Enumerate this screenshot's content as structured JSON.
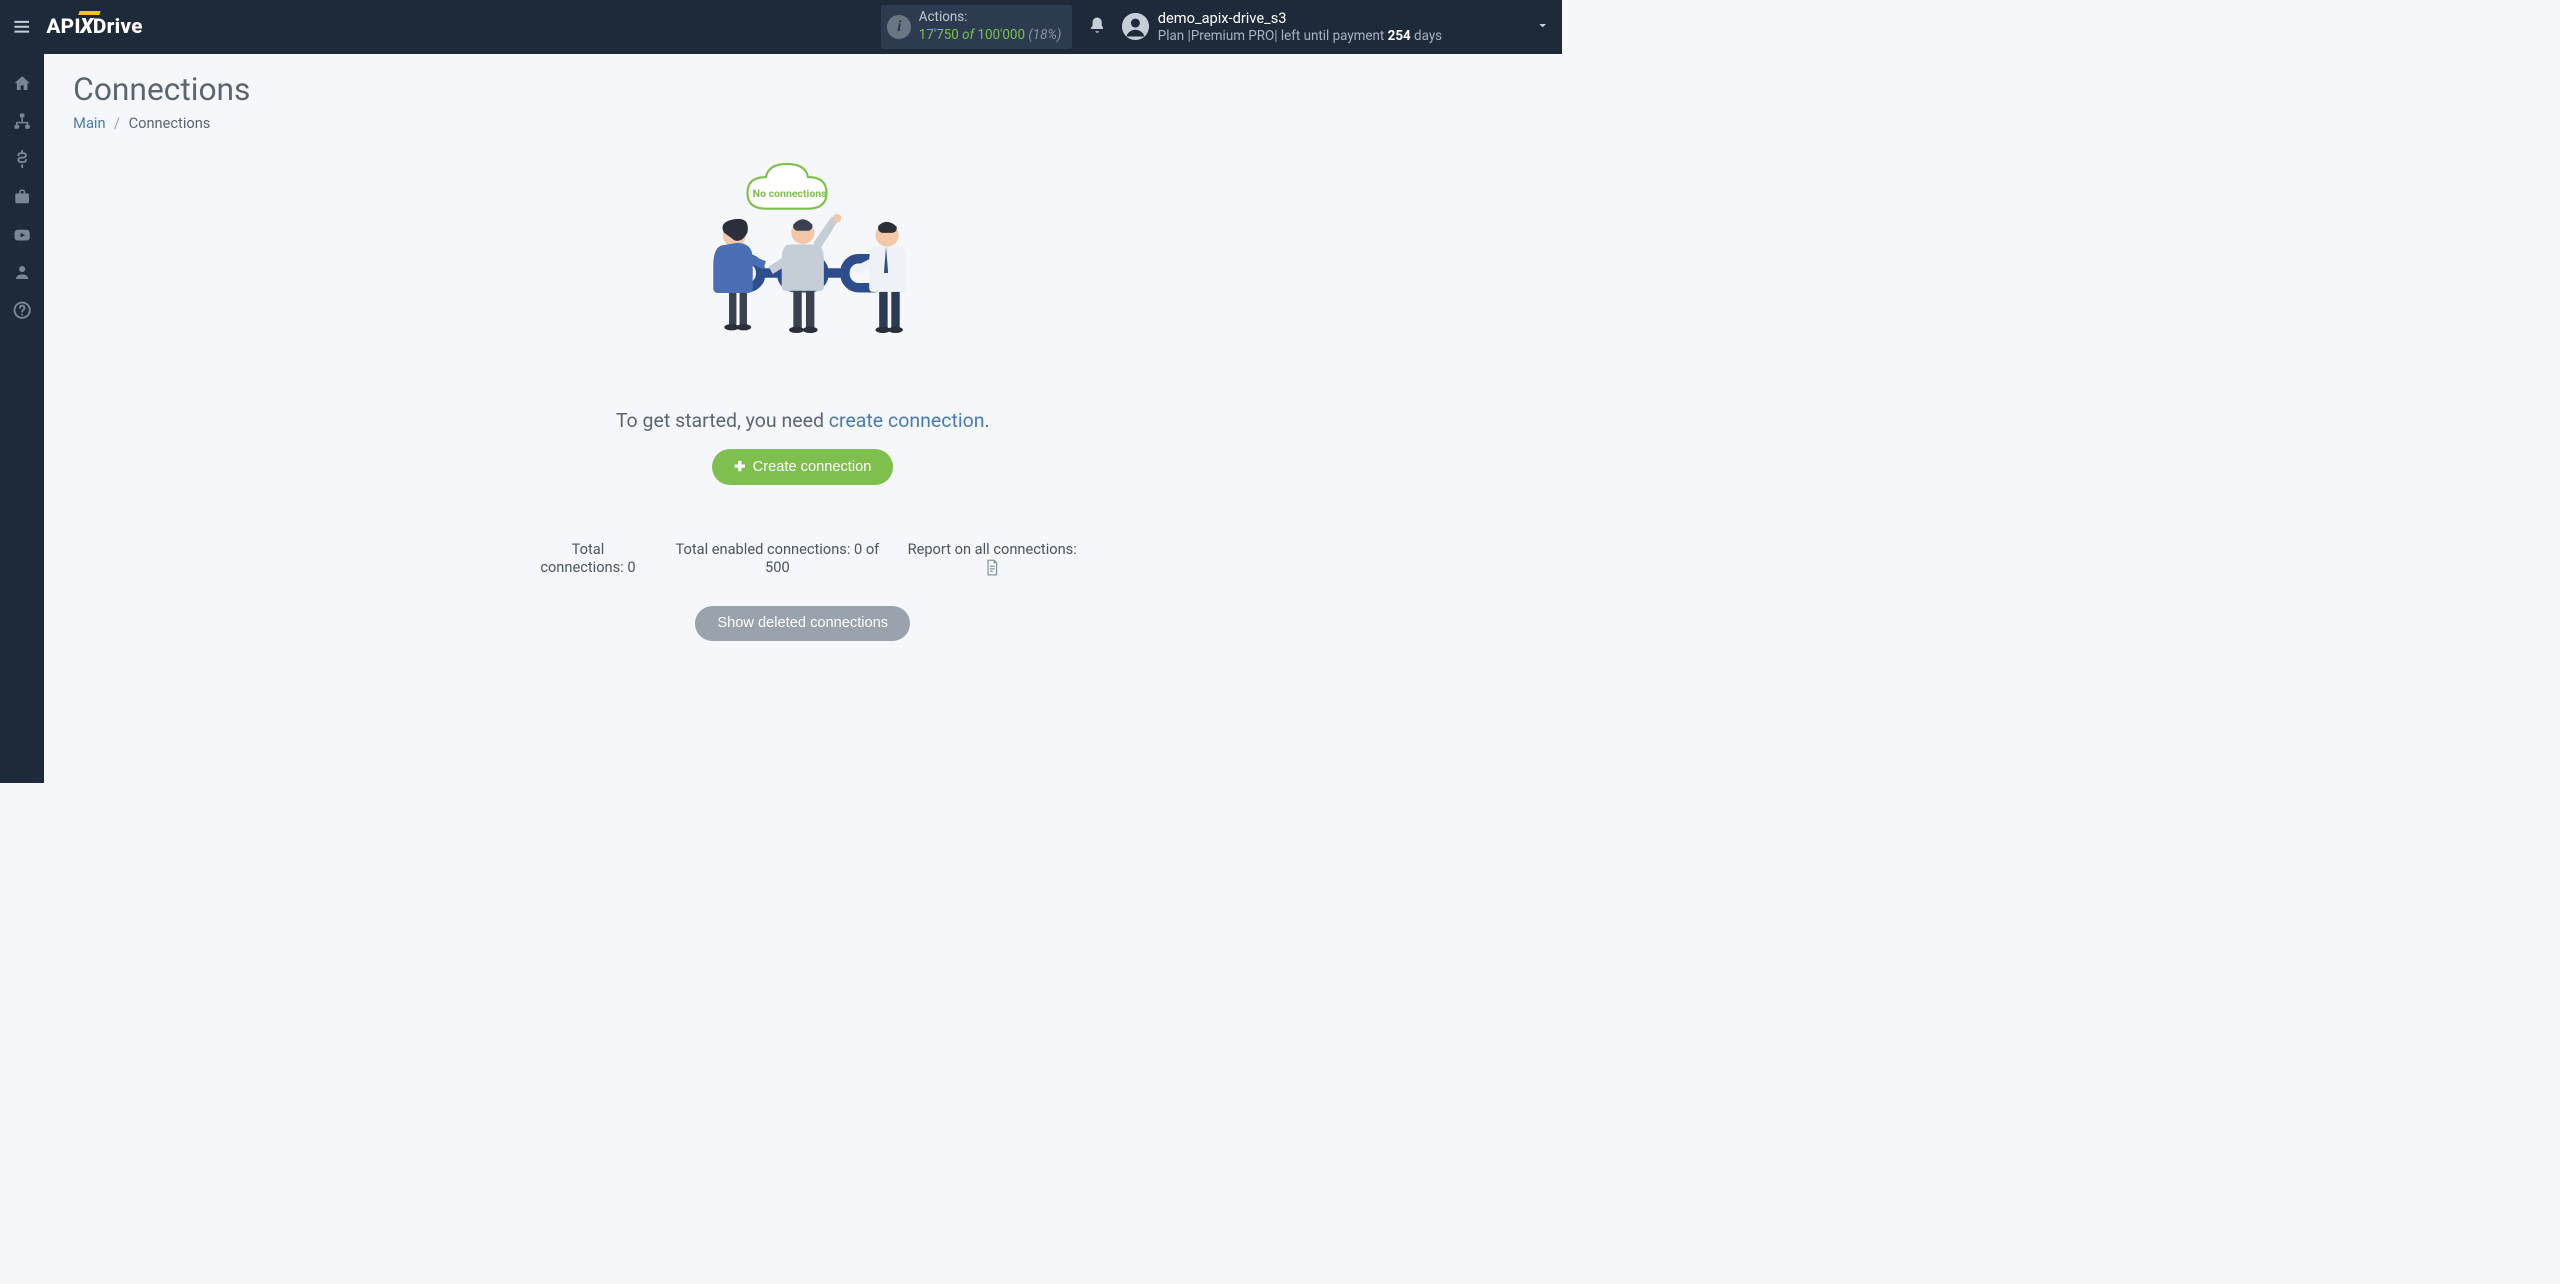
{
  "header": {
    "logo_prefix": "API",
    "logo_x": "X",
    "logo_suffix": "Drive",
    "actions": {
      "label": "Actions:",
      "used": "17'750",
      "of_word": "of",
      "limit": "100'000",
      "pct": "(18%)"
    },
    "user": {
      "name": "demo_apix-drive_s3",
      "plan_prefix": "Plan |",
      "plan_name": "Premium PRO",
      "plan_mid": "| left until payment ",
      "days": "254",
      "days_suffix": " days"
    }
  },
  "page": {
    "title": "Connections",
    "breadcrumb_main": "Main",
    "breadcrumb_current": "Connections"
  },
  "empty": {
    "cloud_text": "No connections",
    "cta_prefix": "To get started, you need ",
    "cta_link": "create connection",
    "cta_suffix": ".",
    "create_btn": "Create connection"
  },
  "stats": {
    "total": "Total connections: 0",
    "enabled": "Total enabled connections: 0 of 500",
    "report": "Report on all connections:"
  },
  "deleted_btn": "Show deleted connections"
}
